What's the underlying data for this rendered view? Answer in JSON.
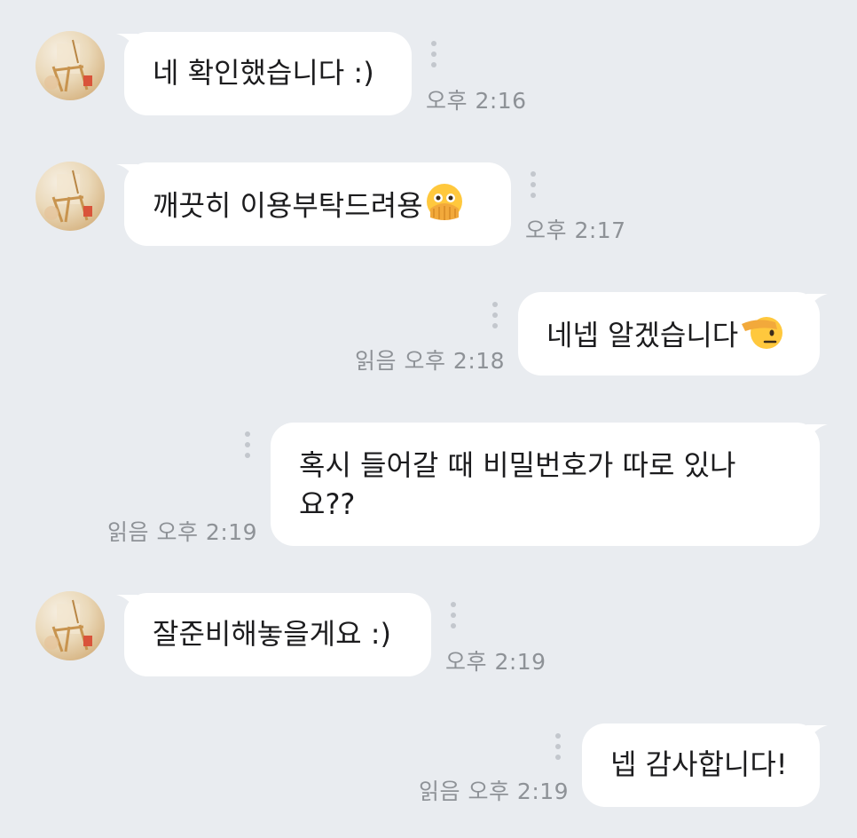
{
  "messages": [
    {
      "direction": "in",
      "text": "네 확인했습니다 :)",
      "time": "오후 2:16"
    },
    {
      "direction": "in",
      "text": "깨끗히 이용부탁드려용",
      "emoji": "face-with-open-eyes-and-hand-over-mouth",
      "time": "오후 2:17"
    },
    {
      "direction": "out",
      "text": "네넵 알겠습니다",
      "emoji": "saluting-face",
      "read": "읽음",
      "time": "오후 2:18"
    },
    {
      "direction": "out",
      "line1": "혹시 들어갈 때 비밀번호가 따로 있나",
      "line2": "요??",
      "read": "읽음",
      "time": "오후 2:19"
    },
    {
      "direction": "in",
      "text": "잘준비해놓을게요 :)",
      "time": "오후 2:19"
    },
    {
      "direction": "out",
      "text": "넵 감사합니다!",
      "read": "읽음",
      "time": "오후 2:19"
    }
  ],
  "colors": {
    "background": "#e9ecf0",
    "bubble": "#ffffff",
    "text": "#1c1c1e",
    "timestamp": "#8e9297"
  }
}
